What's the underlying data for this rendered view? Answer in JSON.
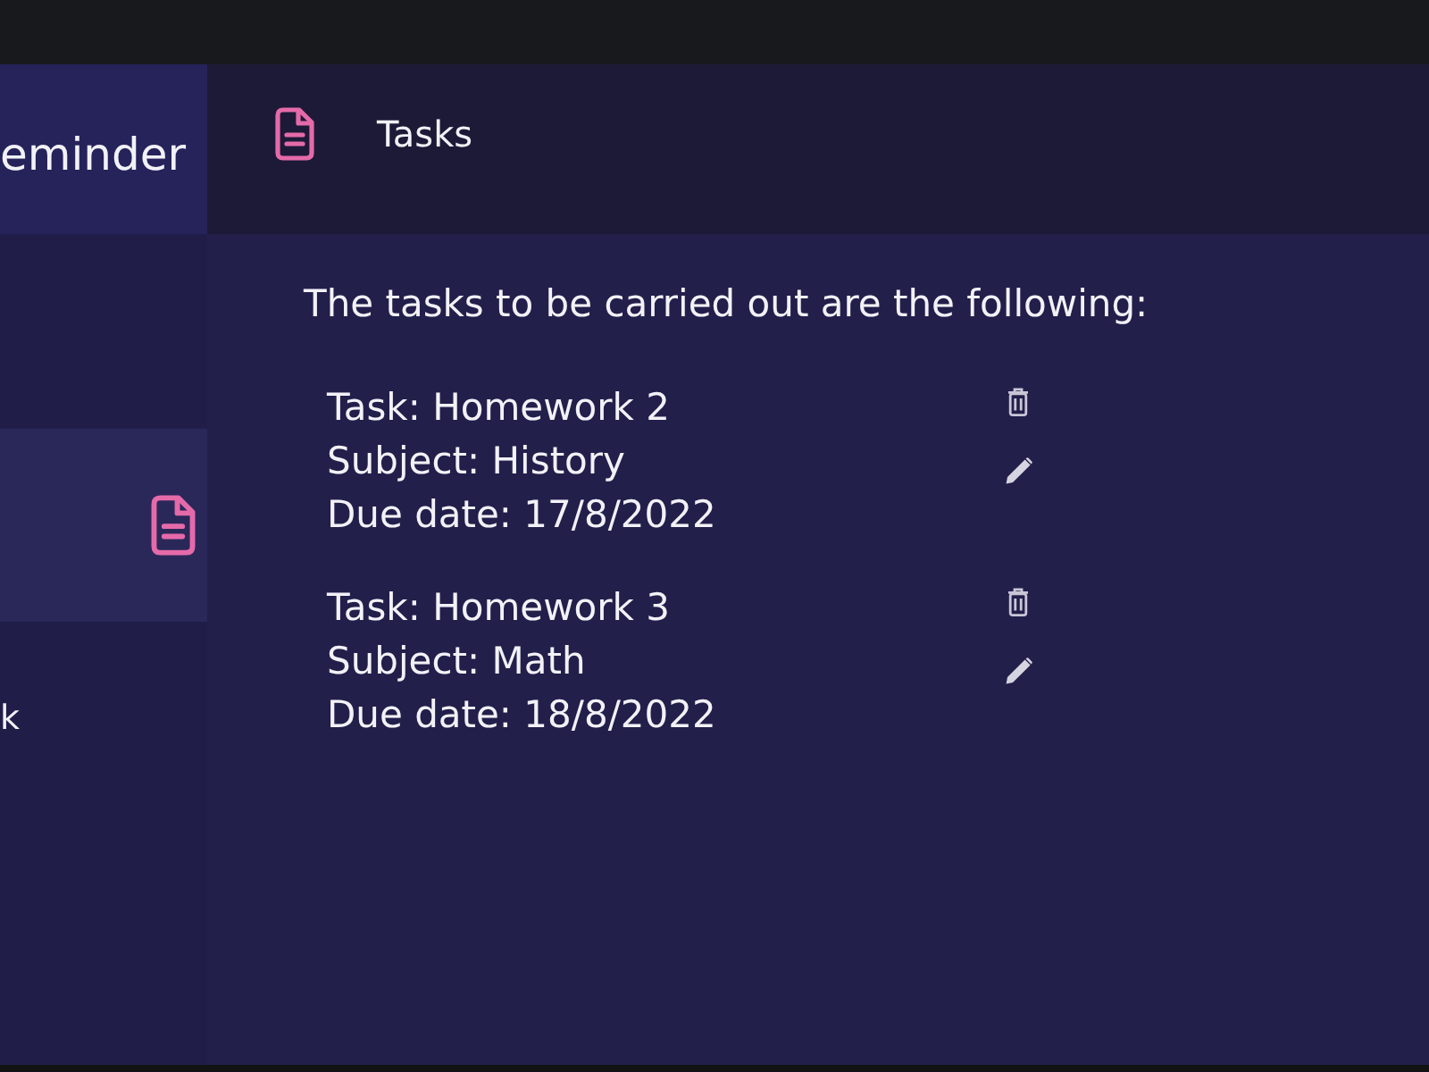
{
  "sidebar": {
    "title": "eminder",
    "items": [
      {
        "kind": "icon",
        "selected": true
      },
      {
        "kind": "text",
        "label": "k",
        "selected": false
      }
    ]
  },
  "header": {
    "title": "Tasks"
  },
  "content": {
    "intro": "The tasks to be carried out are the following:",
    "tasks": [
      {
        "lines": [
          "Task: Homework 2",
          "Subject: History",
          "Due date: 17/8/2022"
        ]
      },
      {
        "lines": [
          "Task: Homework 3",
          "Subject: Math",
          "Due date: 18/8/2022"
        ]
      }
    ]
  }
}
